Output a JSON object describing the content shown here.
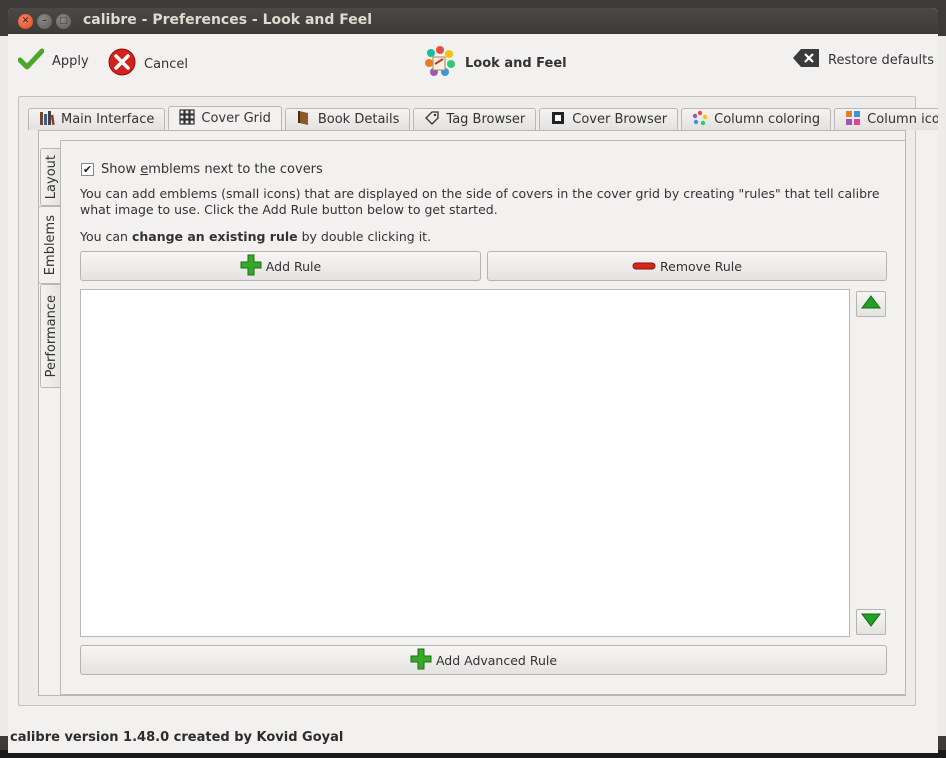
{
  "window": {
    "title": "calibre - Preferences - Look and Feel"
  },
  "toolbar": {
    "apply_label": "Apply",
    "cancel_label": "Cancel",
    "section_label": "Look and Feel",
    "restore_label": "Restore defaults"
  },
  "tabs": [
    {
      "label": "Main Interface",
      "icon": "books-icon"
    },
    {
      "label": "Cover Grid",
      "icon": "grid-icon",
      "active": true
    },
    {
      "label": "Book Details",
      "icon": "book-icon"
    },
    {
      "label": "Tag Browser",
      "icon": "tag-icon"
    },
    {
      "label": "Cover Browser",
      "icon": "cover-icon"
    },
    {
      "label": "Column coloring",
      "icon": "palette-icon"
    },
    {
      "label": "Column icons",
      "icon": "icons-icon"
    }
  ],
  "side_tabs": [
    {
      "label": "Layout"
    },
    {
      "label": "Emblems",
      "active": true
    },
    {
      "label": "Performance"
    }
  ],
  "emblems": {
    "checkbox_label": "Show emblems next to the covers",
    "checkbox_mnemonic": "e",
    "checked": true,
    "description": "You can add emblems (small icons) that are displayed on the side of covers in the cover grid by creating \"rules\" that tell calibre what image to use. Click the Add Rule button below to get started.",
    "hint_prefix": "You can ",
    "hint_bold": "change an existing rule",
    "hint_suffix": " by double clicking it.",
    "add_rule_label": "Add Rule",
    "remove_rule_label": "Remove Rule",
    "add_advanced_label": "Add Advanced Rule"
  },
  "status": {
    "text": "calibre version 1.48.0 created by Kovid Goyal"
  },
  "colors": {
    "titlebar": "#3c3b37",
    "window_bg": "#f2f1f0",
    "plus_green": "#2e9e1f",
    "minus_red": "#d7261b",
    "arrow_green": "#22a024"
  }
}
